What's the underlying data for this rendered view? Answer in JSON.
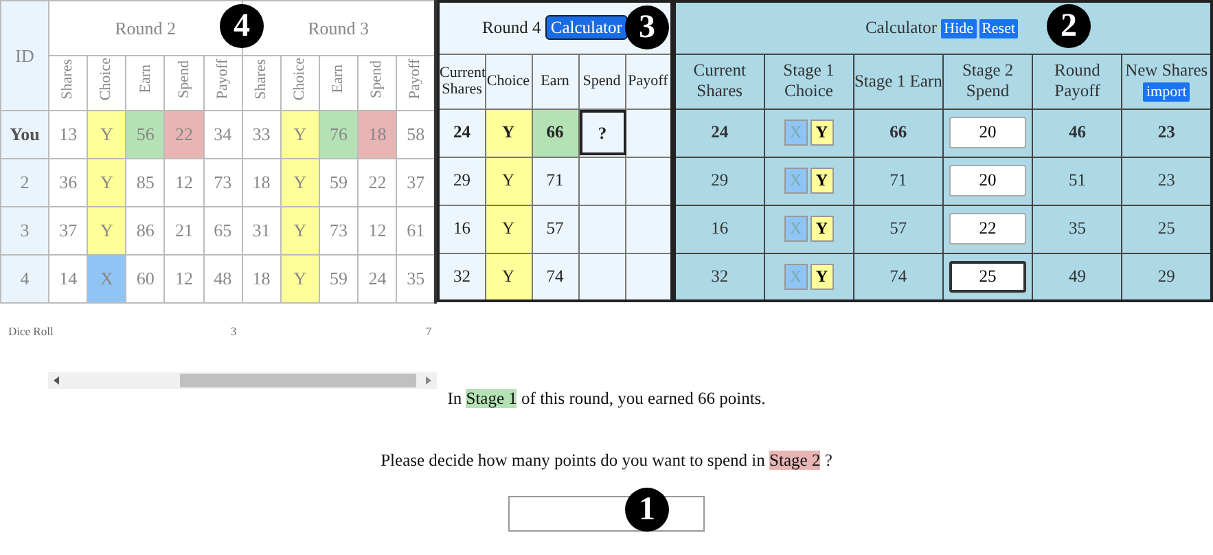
{
  "history": {
    "id_header": "ID",
    "rounds": [
      {
        "title": "Round 2",
        "columns": [
          "Shares",
          "Choice",
          "Earn",
          "Spend",
          "Payoff"
        ]
      },
      {
        "title": "Round 3",
        "columns": [
          "Shares",
          "Choice",
          "Earn",
          "Spend",
          "Payoff"
        ]
      }
    ],
    "rows": [
      {
        "id": "You",
        "bold": true,
        "cells": [
          {
            "text": "13"
          },
          {
            "text": "Y",
            "color": "#ffff99"
          },
          {
            "text": "56",
            "color": "#b4e2b4"
          },
          {
            "text": "22",
            "color": "#e8b4b4"
          },
          {
            "text": "34"
          },
          {
            "text": "33"
          },
          {
            "text": "Y",
            "color": "#ffff99"
          },
          {
            "text": "76",
            "color": "#b4e2b4"
          },
          {
            "text": "18",
            "color": "#e8b4b4"
          },
          {
            "text": "58"
          }
        ]
      },
      {
        "id": "2",
        "bold": false,
        "cells": [
          {
            "text": "36"
          },
          {
            "text": "Y",
            "color": "#ffff99"
          },
          {
            "text": "85"
          },
          {
            "text": "12"
          },
          {
            "text": "73"
          },
          {
            "text": "18"
          },
          {
            "text": "Y",
            "color": "#ffff99"
          },
          {
            "text": "59"
          },
          {
            "text": "22"
          },
          {
            "text": "37"
          }
        ]
      },
      {
        "id": "3",
        "bold": false,
        "cells": [
          {
            "text": "37"
          },
          {
            "text": "Y",
            "color": "#ffff99"
          },
          {
            "text": "86"
          },
          {
            "text": "21"
          },
          {
            "text": "65"
          },
          {
            "text": "31"
          },
          {
            "text": "Y",
            "color": "#ffff99"
          },
          {
            "text": "73"
          },
          {
            "text": "12"
          },
          {
            "text": "61"
          }
        ]
      },
      {
        "id": "4",
        "bold": false,
        "cells": [
          {
            "text": "14"
          },
          {
            "text": "X",
            "color": "#90c4f4"
          },
          {
            "text": "60"
          },
          {
            "text": "12"
          },
          {
            "text": "48"
          },
          {
            "text": "18"
          },
          {
            "text": "Y",
            "color": "#ffff99"
          },
          {
            "text": "59"
          },
          {
            "text": "24"
          },
          {
            "text": "35"
          }
        ]
      }
    ],
    "dice_roll": {
      "label": "Dice Roll",
      "values": [
        "3",
        "7"
      ]
    }
  },
  "round4": {
    "title": "Round 4",
    "calculator_button": "Calculator",
    "columns": [
      "Current Shares",
      "Choice",
      "Earn",
      "Spend",
      "Payoff"
    ],
    "rows": [
      {
        "bold": true,
        "cells": [
          {
            "text": "24"
          },
          {
            "text": "Y",
            "color": "#ffff99"
          },
          {
            "text": "66",
            "color": "#b4e2b4"
          },
          {
            "text": "?",
            "kind": "current"
          }
        ]
      },
      {
        "bold": false,
        "cells": [
          {
            "text": "29"
          },
          {
            "text": "Y",
            "color": "#ffff99"
          },
          {
            "text": "71"
          }
        ]
      },
      {
        "bold": false,
        "cells": [
          {
            "text": "16"
          },
          {
            "text": "Y",
            "color": "#ffff99"
          },
          {
            "text": "57"
          }
        ]
      },
      {
        "bold": false,
        "cells": [
          {
            "text": "32"
          },
          {
            "text": "Y",
            "color": "#ffff99"
          },
          {
            "text": "74"
          }
        ]
      }
    ]
  },
  "calculator": {
    "title": "Calculator",
    "buttons": [
      "Hide",
      "Reset"
    ],
    "columns": [
      "Current Shares",
      "Stage 1 Choice",
      "Stage 1 Earn",
      "Stage 2 Spend",
      "Round Payoff",
      "New Shares"
    ],
    "import_button": "import",
    "rows": [
      {
        "bold": true,
        "shares": "24",
        "choices": [
          {
            "label": "X",
            "selected": false
          },
          {
            "label": "Y",
            "selected": true
          }
        ],
        "earn": "66",
        "spend": "20",
        "focused": false,
        "payoff": "46",
        "new_shares": "23"
      },
      {
        "bold": false,
        "shares": "29",
        "choices": [
          {
            "label": "X",
            "selected": false
          },
          {
            "label": "Y",
            "selected": true
          }
        ],
        "earn": "71",
        "spend": "20",
        "focused": false,
        "payoff": "51",
        "new_shares": "23"
      },
      {
        "bold": false,
        "shares": "16",
        "choices": [
          {
            "label": "X",
            "selected": false
          },
          {
            "label": "Y",
            "selected": true
          }
        ],
        "earn": "57",
        "spend": "22",
        "focused": false,
        "payoff": "35",
        "new_shares": "25"
      },
      {
        "bold": false,
        "shares": "32",
        "choices": [
          {
            "label": "X",
            "selected": false
          },
          {
            "label": "Y",
            "selected": true
          }
        ],
        "earn": "74",
        "spend": "25",
        "focused": true,
        "payoff": "49",
        "new_shares": "29"
      }
    ]
  },
  "prompt": {
    "sentences": [
      [
        {
          "text": "In "
        },
        {
          "text": "Stage 1",
          "color": "#b4e2b4"
        },
        {
          "text": " of this round, you earned 66 points."
        }
      ],
      [
        {
          "text": "Please decide how many points do you want to spend in "
        },
        {
          "text": "Stage 2",
          "color": "#e8b4b4"
        },
        {
          "text": " ?"
        }
      ]
    ]
  },
  "markers": [
    "4",
    "3",
    "2",
    "1"
  ]
}
